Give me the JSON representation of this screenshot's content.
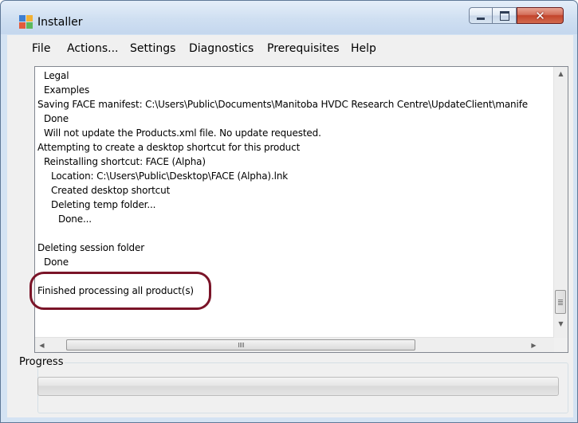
{
  "window": {
    "title": "Installer",
    "icon": "installer-app-icon",
    "controls": {
      "minimize": "minimize-icon",
      "maximize": "maximize-icon",
      "close": "close-icon",
      "close_glyph": "✕"
    }
  },
  "menu": [
    "File",
    "Actions...",
    "Settings",
    "Diagnostics",
    "Prerequisites",
    "Help"
  ],
  "log": {
    "lines": [
      "Legal",
      "Examples",
      "Saving FACE manifest: C:\\Users\\Public\\Documents\\Manitoba HVDC Research Centre\\UpdateClient\\manife",
      "Done",
      "Will not update the Products.xml file. No update requested.",
      "Attempting to create a desktop shortcut for this product",
      "Reinstalling shortcut: FACE (Alpha)",
      "Location: C:\\Users\\Public\\Desktop\\FACE (Alpha).lnk",
      "Created desktop shortcut",
      "Deleting temp folder...",
      "Done...",
      "",
      "Deleting session folder",
      "Done",
      "",
      "Finished processing all product(s)"
    ],
    "scroll_up_glyph": "▲",
    "scroll_down_glyph": "▼",
    "scroll_left_glyph": "◀",
    "scroll_right_glyph": "▶"
  },
  "progress": {
    "label": "Progress",
    "value_fraction": 0
  },
  "colors": {
    "highlight": "#7a1428",
    "window_frame": "#d4e3f3",
    "close_button": "#c3442b"
  }
}
